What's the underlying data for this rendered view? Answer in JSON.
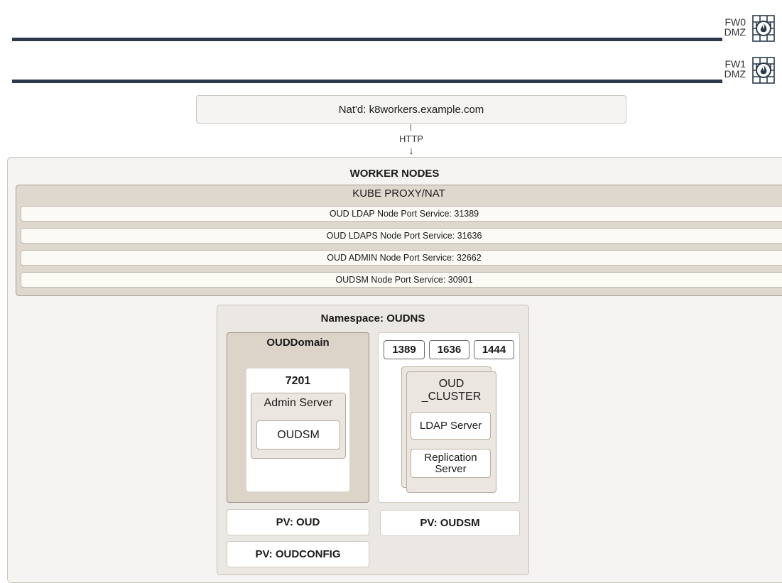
{
  "firewalls": [
    {
      "name": "FW0",
      "zone": "DMZ",
      "icon": "firewall-icon"
    },
    {
      "name": "FW1",
      "zone": "DMZ",
      "icon": "firewall-icon"
    }
  ],
  "nat": {
    "label": "Nat'd: k8workers.example.com"
  },
  "connection": {
    "label": "HTTP",
    "arrow": "↓"
  },
  "worker_nodes": {
    "title": "WORKER NODES",
    "kube_proxy": {
      "title": "KUBE PROXY/NAT",
      "services": [
        "OUD LDAP Node Port Service: 31389",
        "OUD LDAPS Node Port Service: 31636",
        "OUD ADMIN Node Port Service: 32662",
        "OUDSM Node Port Service: 30901"
      ]
    },
    "namespace": {
      "title": "Namespace: OUDNS",
      "domain": {
        "title": "OUDDomain",
        "port": "7201",
        "admin_server": "Admin Server",
        "app": "OUDSM"
      },
      "cluster": {
        "ports": [
          "1389",
          "1636",
          "1444"
        ],
        "title_line1": "OUD",
        "title_line2": "_CLUSTER",
        "ldap_server": "LDAP Server",
        "replication_line1": "Replication",
        "replication_line2": "Server"
      },
      "volumes": {
        "pv_oud": "PV: OUD",
        "pv_oudsm": "PV: OUDSM",
        "pv_oudconfig": "PV: OUDCONFIG"
      }
    }
  },
  "colors": {
    "firewall_bar": "#2b3a4a",
    "kube_proxy_fill": "#dfd8cf",
    "namespace_fill": "#ebe7e2",
    "domain_fill": "#dcd3c9"
  }
}
